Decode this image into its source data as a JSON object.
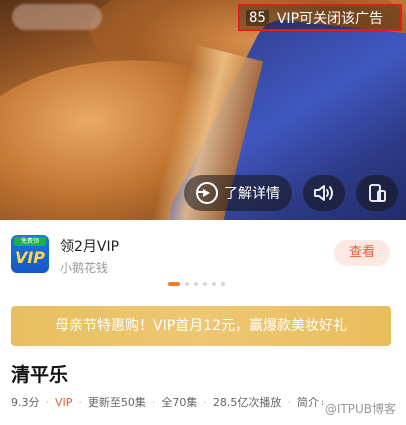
{
  "ad": {
    "countdown": "85",
    "close_label": "VIP可关闭该广告",
    "learn_more": "了解详情",
    "icons": [
      "sound-icon",
      "rotate-screen-icon",
      "arrow-circle-icon"
    ]
  },
  "sponsor": {
    "logo_badge": "免费领",
    "logo_text": "VIP",
    "title": "领2月VIP",
    "subtitle": "小鹅花钱",
    "action": "查看"
  },
  "carousel": {
    "count": 6,
    "active": 0
  },
  "promo": {
    "text": "母亲节特惠购！VIP首月12元，赢爆款美妆好礼",
    "color": "#e8bf5f"
  },
  "show": {
    "title": "清平乐",
    "score": "9.3分",
    "badge": "VIP",
    "update": "更新至50集",
    "total": "全70集",
    "plays": "28.5亿次播放",
    "intro": "简介"
  },
  "watermark": "@ITPUB博客",
  "colors": {
    "accent": "#f15a37",
    "highlight_border": "#e21d1d",
    "promo": "#e8bf5f"
  }
}
